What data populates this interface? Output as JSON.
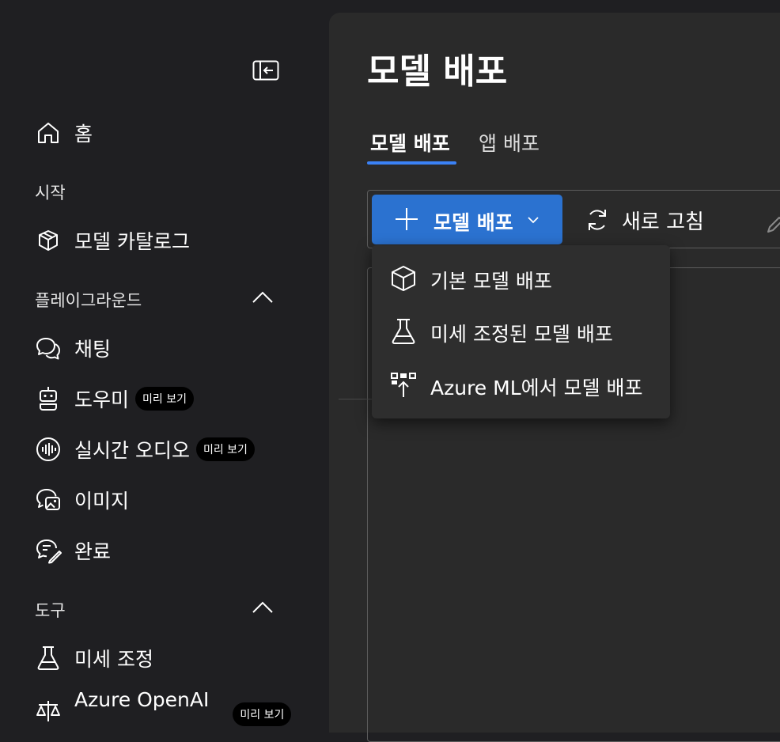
{
  "sidebar": {
    "collapse_icon": "collapse-panel-icon",
    "home": {
      "label": "홈",
      "icon": "home-icon"
    },
    "section_start": {
      "label": "시작"
    },
    "model_catalog": {
      "label": "모델 카탈로그",
      "icon": "cube-catalog-icon"
    },
    "section_playground": {
      "label": "플레이그라운드",
      "expanded": true
    },
    "chat": {
      "label": "채팅",
      "icon": "chat-icon"
    },
    "assistant": {
      "label": "도우미",
      "badge": "미리 보기",
      "icon": "bot-icon"
    },
    "realtime_audio": {
      "label": "실시간 오디오",
      "badge": "미리 보기",
      "icon": "audio-wave-icon"
    },
    "images": {
      "label": "이미지",
      "icon": "image-chat-icon"
    },
    "completions": {
      "label": "완료",
      "icon": "chat-edit-icon"
    },
    "section_tools": {
      "label": "도구",
      "expanded": true
    },
    "fine_tuning": {
      "label": "미세 조정",
      "icon": "flask-icon"
    },
    "azure_openai": {
      "label": "Azure OpenAI",
      "badge": "미리 보기",
      "icon": "scale-icon"
    }
  },
  "main": {
    "title": "모델 배포",
    "tabs": [
      {
        "label": "모델 배포",
        "active": true
      },
      {
        "label": "앱 배포",
        "active": false
      }
    ],
    "toolbar": {
      "deploy_label": "모델 배포",
      "refresh_label": "새로 고침"
    },
    "dropdown": {
      "items": [
        {
          "label": "기본 모델 배포",
          "icon": "cube-icon"
        },
        {
          "label": "미세 조정된 모델 배포",
          "icon": "flask-icon"
        },
        {
          "label": "Azure ML에서 모델 배포",
          "icon": "azure-ml-deploy-icon"
        }
      ]
    }
  },
  "colors": {
    "background": "#1f1f22",
    "panel": "#2a2a2a",
    "accent": "#2b72d0",
    "tab_underline": "#3b82f6",
    "badge": "#000000"
  }
}
